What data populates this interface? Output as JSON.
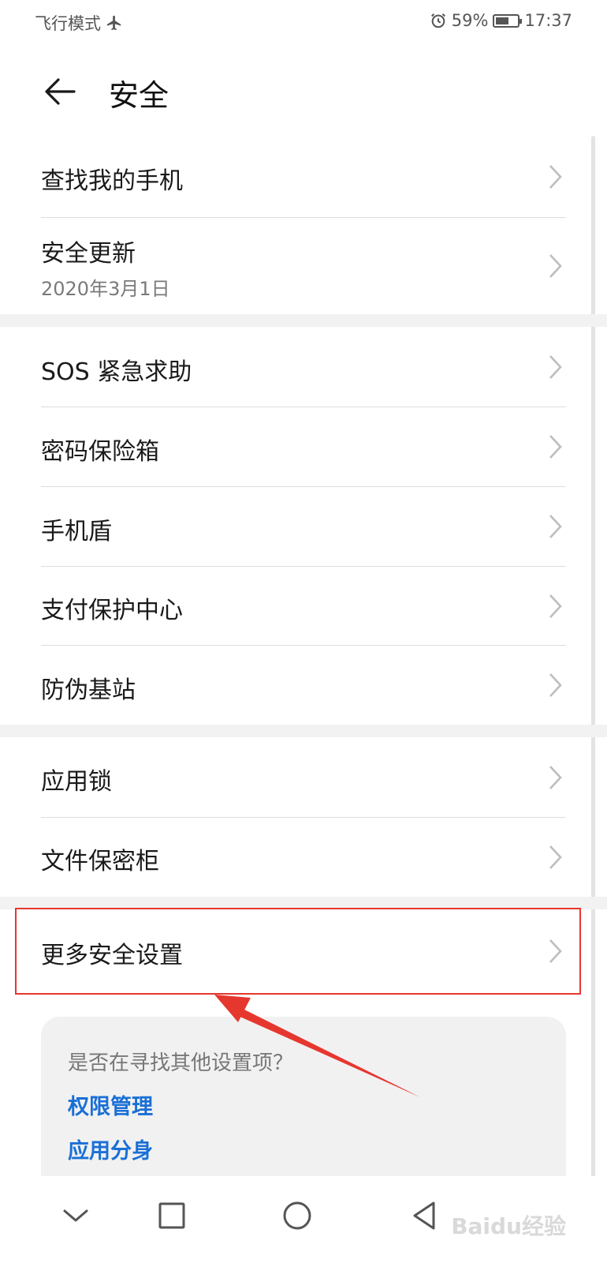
{
  "status_bar": {
    "mode": "飞行模式",
    "battery": "59%",
    "battery_level": 0.59,
    "time": "17:37"
  },
  "header": {
    "title": "安全"
  },
  "groups": [
    {
      "items": [
        {
          "label": "查找我的手机"
        },
        {
          "label": "安全更新",
          "sub": "2020年3月1日"
        }
      ]
    },
    {
      "items": [
        {
          "label": "SOS 紧急求助"
        },
        {
          "label": "密码保险箱"
        },
        {
          "label": "手机盾"
        },
        {
          "label": "支付保护中心"
        },
        {
          "label": "防伪基站"
        }
      ]
    },
    {
      "items": [
        {
          "label": "应用锁"
        },
        {
          "label": "文件保密柜"
        }
      ]
    },
    {
      "items": [
        {
          "label": "更多安全设置"
        }
      ]
    }
  ],
  "suggestions": {
    "title": "是否在寻找其他设置项？",
    "links": [
      "权限管理",
      "应用分身"
    ]
  },
  "watermark": "Baidu经验",
  "icons": [
    "airplane-icon",
    "alarm-icon",
    "battery-icon",
    "back-arrow-icon",
    "chevron-right-icon",
    "nav-back-icon",
    "nav-home-icon",
    "nav-recents-icon",
    "nav-collapse-icon"
  ],
  "colors": {
    "accent_link": "#1a6fd6",
    "annotation_red": "#e6372f"
  }
}
